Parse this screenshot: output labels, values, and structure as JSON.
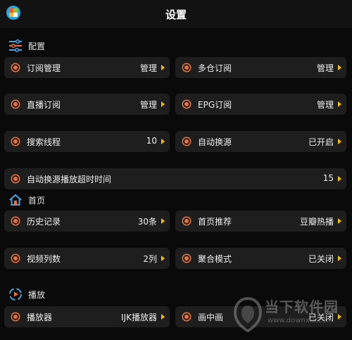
{
  "header": {
    "title": "设置"
  },
  "sections": {
    "config": "配置",
    "home": "首页",
    "playback": "播放"
  },
  "settings": {
    "subscription": {
      "label": "订阅管理",
      "value": "管理"
    },
    "multi_repo": {
      "label": "多仓订阅",
      "value": "管理"
    },
    "live": {
      "label": "直播订阅",
      "value": "管理"
    },
    "epg": {
      "label": "EPG订阅",
      "value": "管理"
    },
    "search_threads": {
      "label": "搜索线程",
      "value": "10"
    },
    "auto_switch": {
      "label": "自动换源",
      "value": "已开启"
    },
    "auto_switch_timeout": {
      "label": "自动换源播放超时时间",
      "value": "15"
    },
    "history": {
      "label": "历史记录",
      "value": "30条"
    },
    "home_recommend": {
      "label": "首页推荐",
      "value": "豆瓣热播"
    },
    "video_columns": {
      "label": "视频列数",
      "value": "2列"
    },
    "aggregate_mode": {
      "label": "聚合模式",
      "value": "已关闭"
    },
    "player": {
      "label": "播放器",
      "value": "IJK播放器"
    },
    "pip": {
      "label": "画中画",
      "value": "已关闭"
    }
  },
  "watermark": {
    "text": "当下软件园",
    "url": "www.downxia.com"
  },
  "colors": {
    "accent": "#e8743b",
    "arrow": "#f2c200",
    "card": "#1e1e1e",
    "background": "#0a0a0a"
  }
}
